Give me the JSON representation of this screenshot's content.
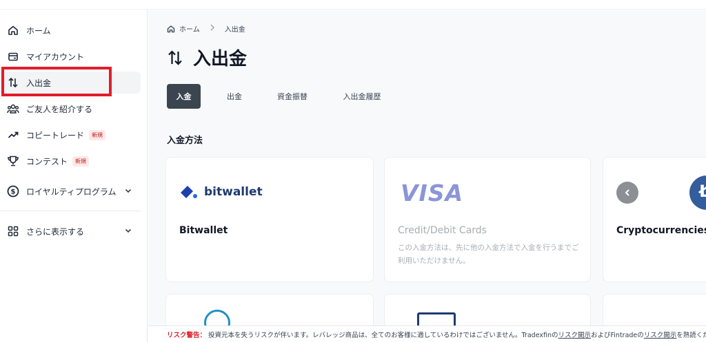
{
  "sidebar": {
    "items": [
      {
        "label": "ホーム",
        "icon": "home-icon"
      },
      {
        "label": "マイアカウント",
        "icon": "wallet-icon"
      },
      {
        "label": "入出金",
        "icon": "transfer-arrows-icon"
      },
      {
        "label": "ご友人を紹介する",
        "icon": "users-icon"
      },
      {
        "label": "コピートレード",
        "icon": "trend-up-icon",
        "badge": "新規"
      },
      {
        "label": "コンテスト",
        "icon": "trophy-icon",
        "badge": "新規"
      },
      {
        "label": "ロイヤルティプログラム",
        "icon": "dollar-circle-icon"
      },
      {
        "label": "さらに表示する",
        "icon": "grid-icon"
      }
    ]
  },
  "breadcrumb": {
    "home": "ホーム",
    "current": "入出金"
  },
  "page_title": "入出金",
  "tabs": [
    {
      "label": "入金"
    },
    {
      "label": "出金"
    },
    {
      "label": "資金振替"
    },
    {
      "label": "入出金履歴"
    }
  ],
  "section_title": "入金方法",
  "methods": [
    {
      "name": "Bitwallet",
      "logo_text": "bitwallet"
    },
    {
      "name": "Credit/Debit Cards",
      "logo_text": "VISA",
      "desc": "この入金方法は、先に他の入金方法で入金を行うまでご利用いただけません。"
    },
    {
      "name": "Cryptocurrencies"
    }
  ],
  "risk": {
    "label": "リスク警告：",
    "text1": "投資元本を失うリスクが伴います。レバレッジ商品は、全てのお客様に適しているわけではございません。Tradexfinの",
    "link1": "リスク開示",
    "text2": "およびFintradeの",
    "link2": "リスク開示",
    "text3": "を熟読くださ"
  },
  "colors": {
    "accent": "#3a4550",
    "highlight": "#e11d2a",
    "visa": "#8b95d8",
    "crypto": "#345d9d"
  }
}
